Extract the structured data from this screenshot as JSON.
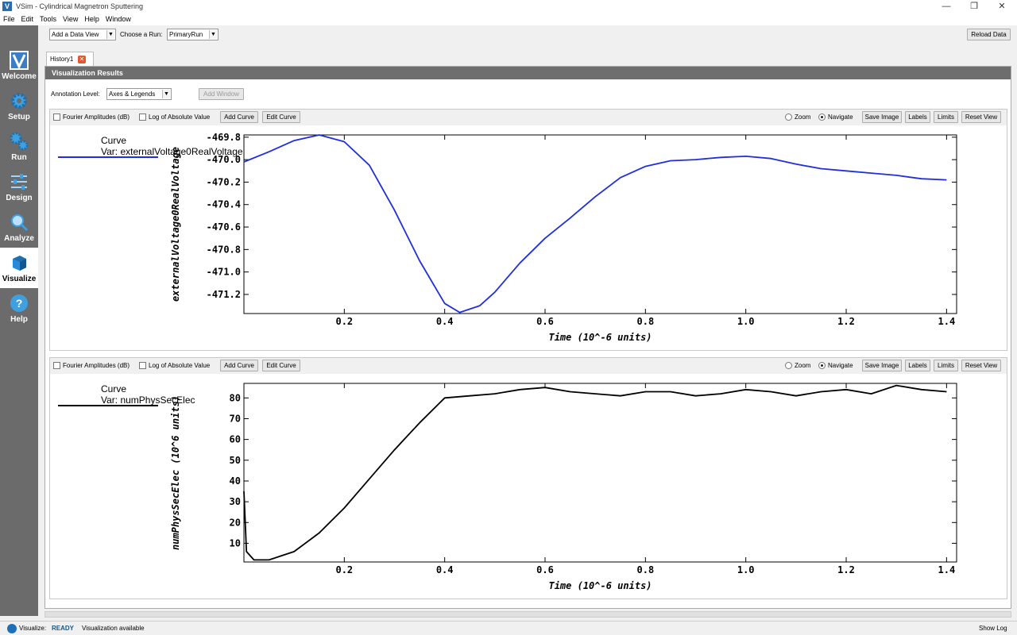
{
  "window": {
    "title": "VSim - Cylindrical Magnetron Sputtering",
    "minimize": "—",
    "restore": "❐",
    "close": "✕",
    "logo": "V"
  },
  "menu": [
    "File",
    "Edit",
    "Tools",
    "View",
    "Help",
    "Window"
  ],
  "sidebar": {
    "items": [
      {
        "label": "Welcome",
        "icon": "vsim-logo-icon"
      },
      {
        "label": "Setup",
        "icon": "gear-icon"
      },
      {
        "label": "Run",
        "icon": "gears-icon"
      },
      {
        "label": "Design",
        "icon": "sliders-icon"
      },
      {
        "label": "Analyze",
        "icon": "magnifier-icon"
      },
      {
        "label": "Visualize",
        "icon": "cube-icon"
      },
      {
        "label": "Help",
        "icon": "question-icon"
      }
    ],
    "active": "Visualize"
  },
  "toolbar": {
    "data_view": "Add a Data View",
    "run_label": "Choose a Run:",
    "run_value": "PrimaryRun",
    "reload": "Reload Data"
  },
  "tab": {
    "label": "History1"
  },
  "panel": {
    "header": "Visualization Results",
    "annotation_label": "Annotation Level:",
    "annotation_value": "Axes & Legends",
    "add_window": "Add Window"
  },
  "plot_controls": {
    "fourier": "Fourier Amplitudes (dB)",
    "log_abs": "Log of Absolute Value",
    "add_curve": "Add Curve",
    "edit_curve": "Edit Curve",
    "zoom": "Zoom",
    "navigate": "Navigate",
    "save_image": "Save Image",
    "labels": "Labels",
    "limits": "Limits",
    "reset_view": "Reset View"
  },
  "colors": {
    "series1": "#1f2fe0",
    "series2": "#000000",
    "sidebar": "#6b6b6b",
    "header": "#6e6e6e"
  },
  "chart_data": [
    {
      "type": "line",
      "legend_title": "Curve",
      "series": [
        {
          "name": "Var: externalVoltage0RealVoltage",
          "color": "#1f2fe0",
          "x": [
            0.0,
            0.05,
            0.1,
            0.15,
            0.2,
            0.25,
            0.3,
            0.35,
            0.4,
            0.43,
            0.47,
            0.5,
            0.55,
            0.6,
            0.65,
            0.7,
            0.75,
            0.8,
            0.85,
            0.9,
            0.95,
            1.0,
            1.05,
            1.1,
            1.15,
            1.2,
            1.25,
            1.3,
            1.35,
            1.4
          ],
          "y": [
            -470.02,
            -469.93,
            -469.83,
            -469.78,
            -469.84,
            -470.05,
            -470.45,
            -470.9,
            -471.28,
            -471.36,
            -471.3,
            -471.18,
            -470.92,
            -470.7,
            -470.52,
            -470.33,
            -470.16,
            -470.06,
            -470.01,
            -470.0,
            -469.98,
            -469.97,
            -469.99,
            -470.04,
            -470.08,
            -470.1,
            -470.12,
            -470.14,
            -470.17,
            -470.18
          ]
        }
      ],
      "xlabel": "Time (10^-6 units)",
      "ylabel": "externalVoltage0RealVoltage",
      "xlim": [
        0.0,
        1.42
      ],
      "ylim": [
        -471.37,
        -469.78
      ],
      "xticks": [
        0.2,
        0.4,
        0.6,
        0.8,
        1.0,
        1.2,
        1.4
      ],
      "xtick_labels": [
        "0.2",
        "0.4",
        "0.6",
        "0.8",
        "1.0",
        "1.2",
        "1.4"
      ],
      "yticks": [
        -469.8,
        -470.0,
        -470.2,
        -470.4,
        -470.6,
        -470.8,
        -471.0,
        -471.2
      ],
      "ytick_labels": [
        "-469.8",
        "-470.0",
        "-470.2",
        "-470.4",
        "-470.6",
        "-470.8",
        "-471.0",
        "-471.2"
      ],
      "legend": "top-left"
    },
    {
      "type": "line",
      "legend_title": "Curve",
      "series": [
        {
          "name": "Var: numPhysSecElec",
          "color": "#000000",
          "x": [
            0.0,
            0.005,
            0.02,
            0.05,
            0.1,
            0.15,
            0.2,
            0.25,
            0.3,
            0.35,
            0.4,
            0.45,
            0.5,
            0.55,
            0.6,
            0.65,
            0.7,
            0.75,
            0.8,
            0.85,
            0.9,
            0.95,
            1.0,
            1.05,
            1.1,
            1.15,
            1.2,
            1.25,
            1.3,
            1.35,
            1.4
          ],
          "y": [
            35,
            6,
            2,
            2,
            6,
            15,
            27,
            41,
            55,
            68,
            80,
            81,
            82,
            84,
            85,
            83,
            82,
            81,
            83,
            83,
            81,
            82,
            84,
            83,
            81,
            83,
            84,
            82,
            86,
            84,
            83
          ]
        }
      ],
      "xlabel": "Time (10^-6 units)",
      "ylabel": "numPhysSecElec (10^6 units)",
      "xlim": [
        0.0,
        1.42
      ],
      "ylim": [
        1,
        87
      ],
      "xticks": [
        0.2,
        0.4,
        0.6,
        0.8,
        1.0,
        1.2,
        1.4
      ],
      "xtick_labels": [
        "0.2",
        "0.4",
        "0.6",
        "0.8",
        "1.0",
        "1.2",
        "1.4"
      ],
      "yticks": [
        10,
        20,
        30,
        40,
        50,
        60,
        70,
        80
      ],
      "ytick_labels": [
        "10",
        "20",
        "30",
        "40",
        "50",
        "60",
        "70",
        "80"
      ],
      "legend": "top-left"
    }
  ],
  "status": {
    "section": "Visualize:",
    "state": "READY",
    "message": "Visualization available",
    "show_log": "Show Log"
  }
}
